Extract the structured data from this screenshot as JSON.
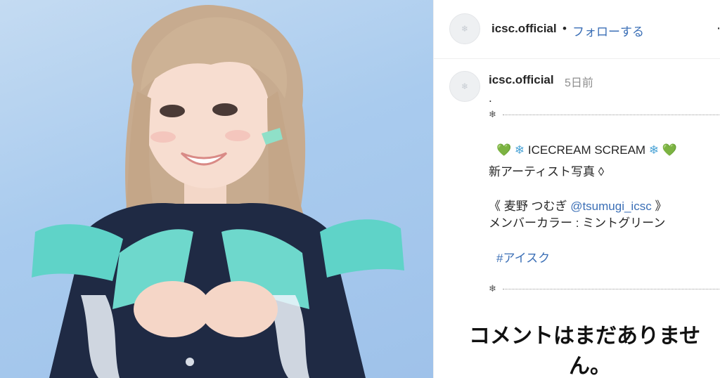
{
  "header": {
    "username": "icsc.official",
    "separator": "•",
    "follow_label": "フォローする",
    "more_icon": "more-options-icon"
  },
  "post": {
    "username": "icsc.official",
    "time": "5日前",
    "dot_line": ".",
    "divider_icon": "❄",
    "title_heart_left": "💚",
    "title_flake_left": "❄",
    "title": "ICECREAM SCREAM",
    "title_flake_right": "❄",
    "title_heart_right": "💚",
    "subtitle": "新アーティスト写真",
    "subtitle_mark": "◊",
    "member_open": "《 麦野 つむぎ",
    "member_mention": "@tsumugi_icsc",
    "member_close": "》",
    "member_color": "メンバーカラー : ミントグリーン",
    "hashtag": "#アイスク"
  },
  "comments": {
    "empty_line1": "コメントはまだありませ",
    "empty_line2": "ん。"
  },
  "colors": {
    "link": "#3b6fb6",
    "mint": "#5fd3c8",
    "navy": "#1a2236",
    "background_photo": "#a9cbee"
  }
}
